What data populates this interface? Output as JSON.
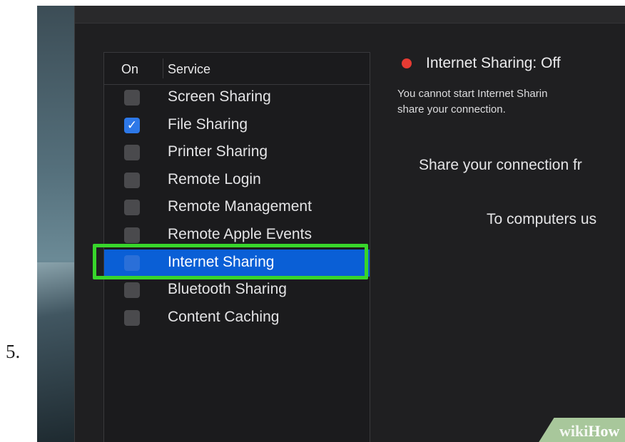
{
  "step_number": "5.",
  "table": {
    "header_on": "On",
    "header_service": "Service",
    "rows": [
      {
        "label": "Screen Sharing",
        "checked": false
      },
      {
        "label": "File Sharing",
        "checked": true
      },
      {
        "label": "Printer Sharing",
        "checked": false
      },
      {
        "label": "Remote Login",
        "checked": false
      },
      {
        "label": "Remote Management",
        "checked": false
      },
      {
        "label": "Remote Apple Events",
        "checked": false
      },
      {
        "label": "Internet Sharing",
        "checked": false,
        "selected": true
      },
      {
        "label": "Bluetooth Sharing",
        "checked": false
      },
      {
        "label": "Content Caching",
        "checked": false
      }
    ]
  },
  "detail": {
    "status_title": "Internet Sharing: Off",
    "status_color": "#e53b33",
    "description_line1": "You cannot start Internet Sharin",
    "description_line2": "share your connection.",
    "share_from_label": "Share your connection fr",
    "to_computers_label": "To computers us"
  },
  "highlight_color": "#38d62b",
  "checkmark_glyph": "✓",
  "watermark": {
    "part1": "wiki",
    "part2": "How"
  }
}
